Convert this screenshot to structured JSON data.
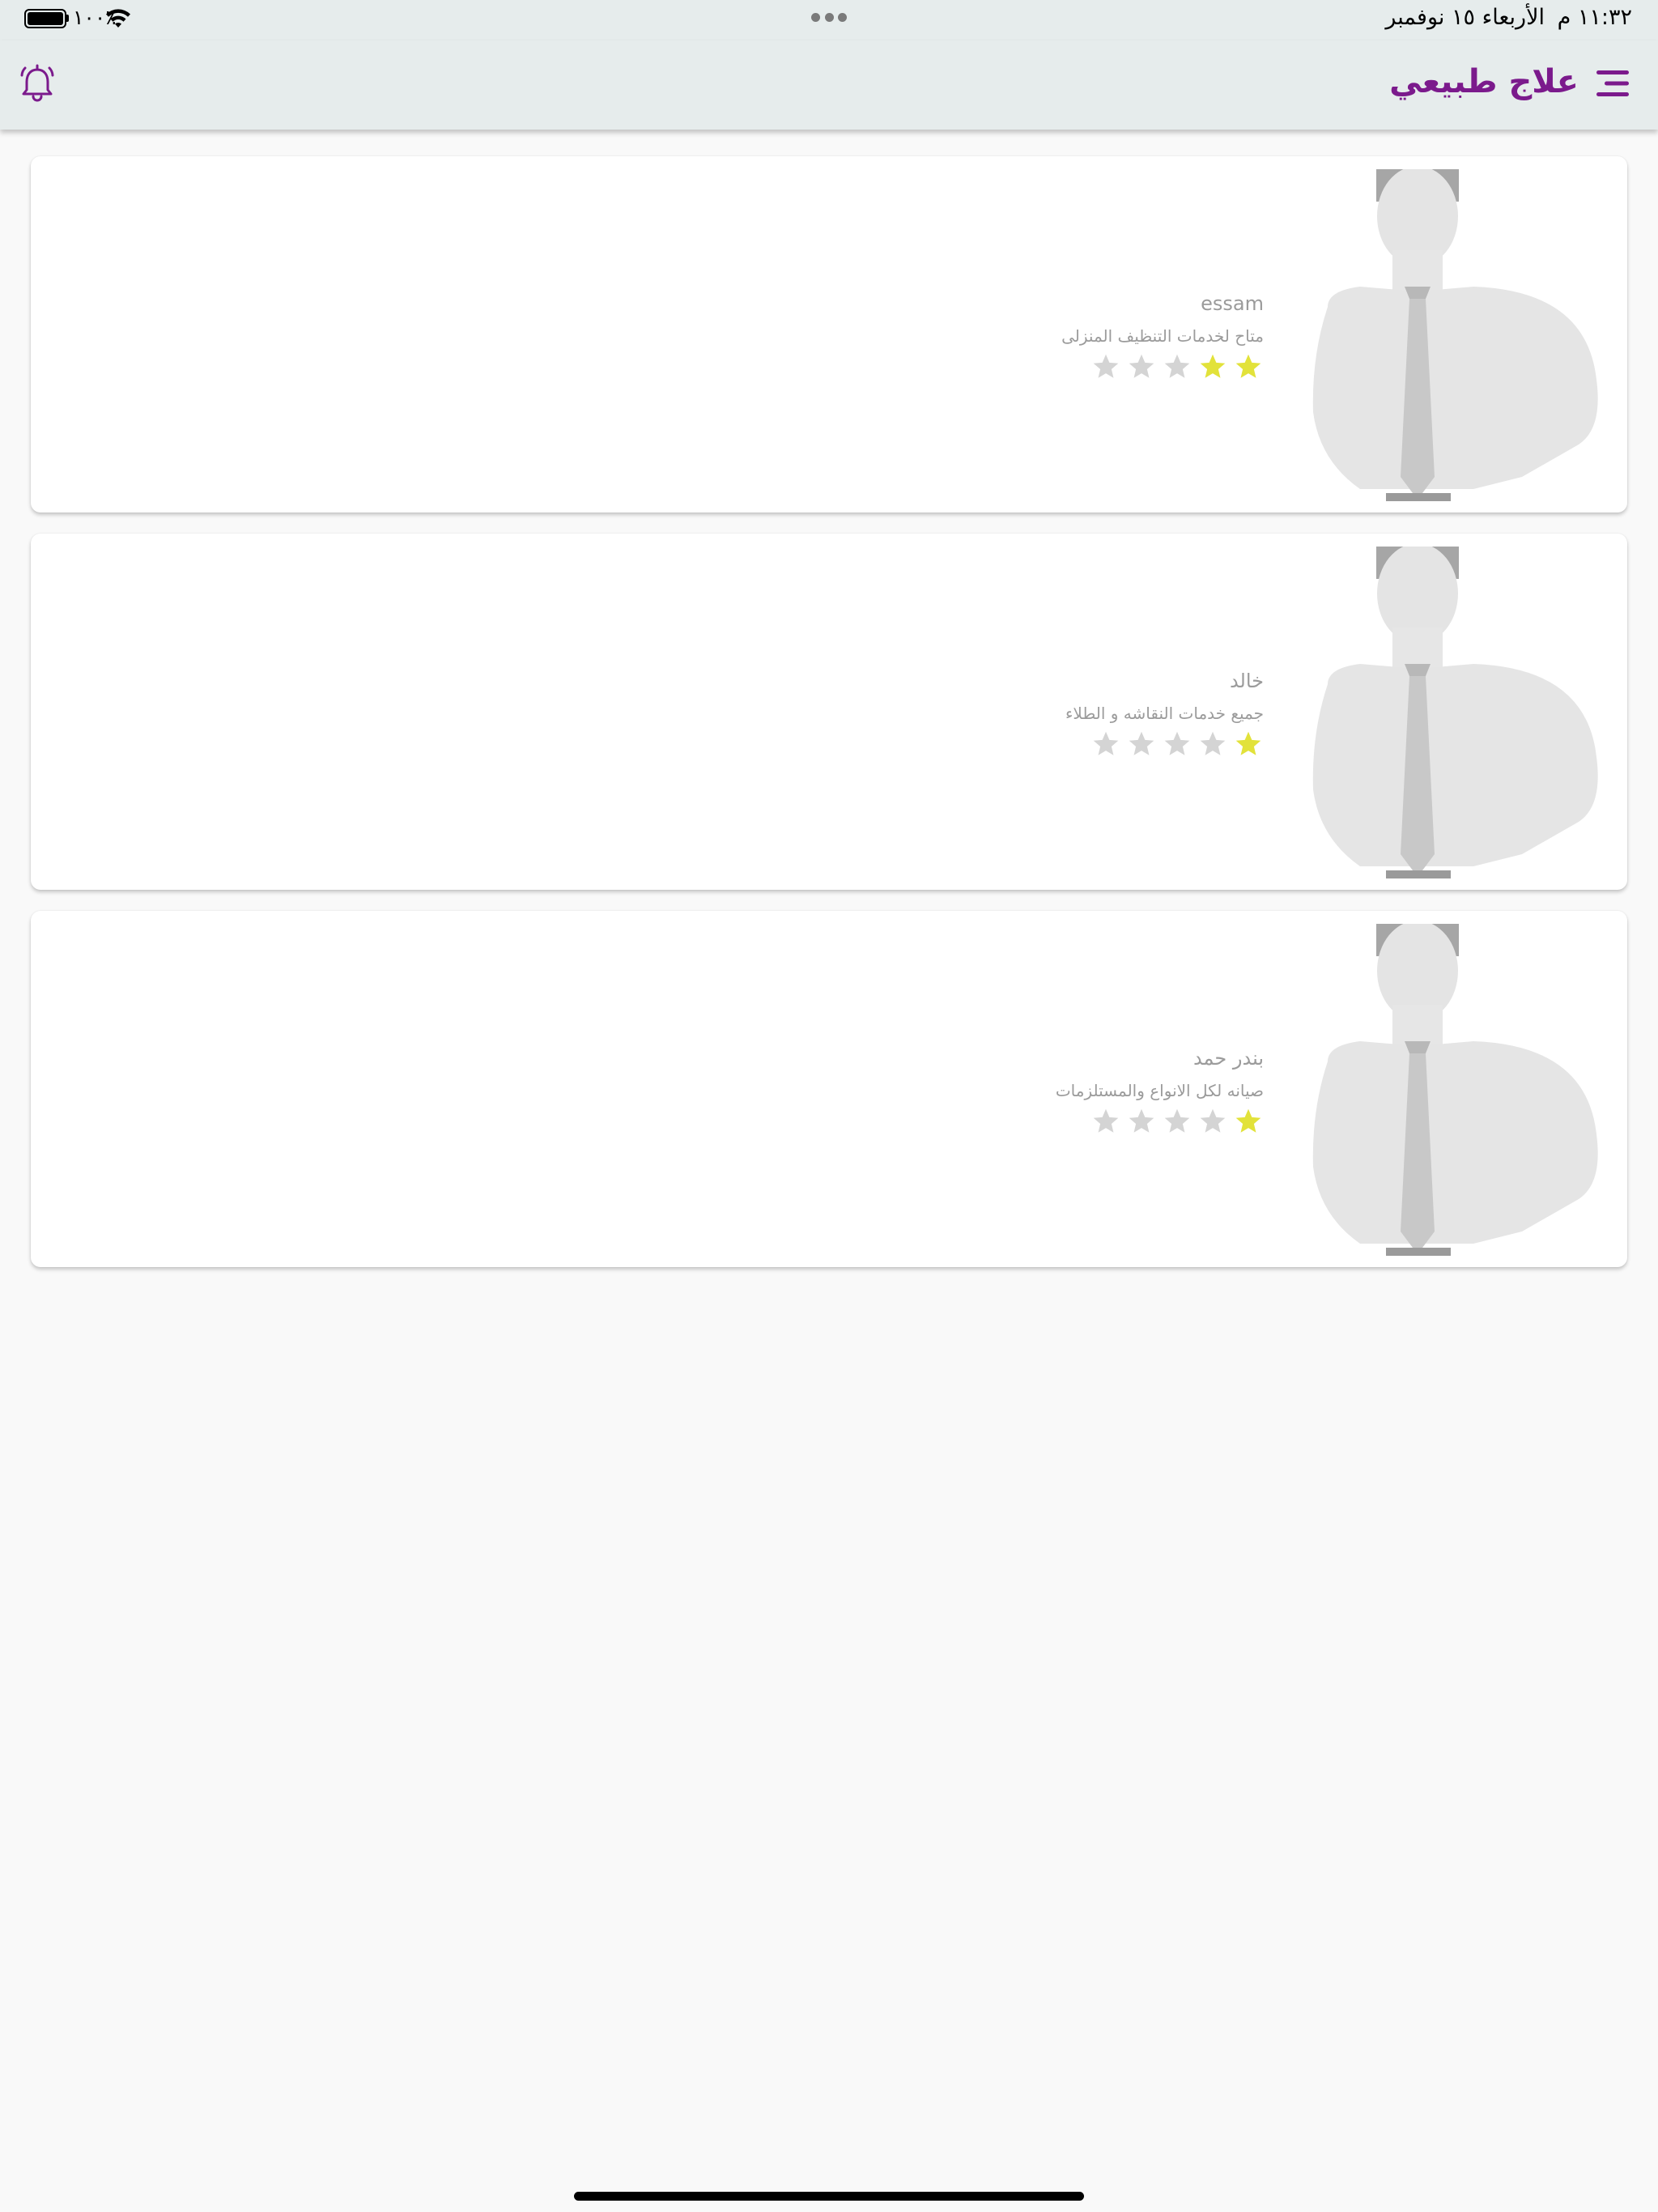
{
  "status_bar": {
    "time": "١١:٣٢ م",
    "date": "الأربعاء ١٥ نوفمبر",
    "battery": "١٠٠٪"
  },
  "header": {
    "title": "علاج طبيعي"
  },
  "providers": [
    {
      "name": "essam",
      "description": "متاح لخدمات التنظيف المنزلى",
      "rating": 2,
      "max_rating": 5
    },
    {
      "name": "خالد",
      "description": "جميع خدمات النقاشه و الطلاء",
      "rating": 1,
      "max_rating": 5
    },
    {
      "name": "بندر حمد",
      "description": "صيانه لكل الانواع والمستلزمات",
      "rating": 1,
      "max_rating": 5
    }
  ],
  "colors": {
    "accent": "#7b1a8c",
    "header_bg": "#e6ecec",
    "star_on": "#e2e23a",
    "star_off": "#d4d4d4"
  },
  "icons": {
    "menu": "menu-icon",
    "notifications": "bell-icon",
    "wifi": "wifi-icon",
    "battery": "battery-icon"
  }
}
